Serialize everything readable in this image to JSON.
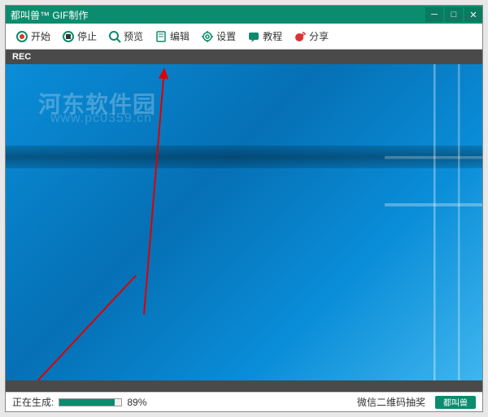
{
  "window": {
    "title": "都叫兽™ GIF制作"
  },
  "toolbar": {
    "start": "开始",
    "stop": "停止",
    "preview": "预览",
    "edit": "编辑",
    "settings": "设置",
    "tutorial": "教程",
    "share": "分享"
  },
  "rec_label": "REC",
  "watermark": {
    "main": "河东软件园",
    "sub": "www.pc0359.cn"
  },
  "status": {
    "generating_label": "正在生成:",
    "percent_text": "89%",
    "percent_value": 89,
    "wechat_label": "微信二维码抽奖",
    "brand": "都叫兽"
  }
}
